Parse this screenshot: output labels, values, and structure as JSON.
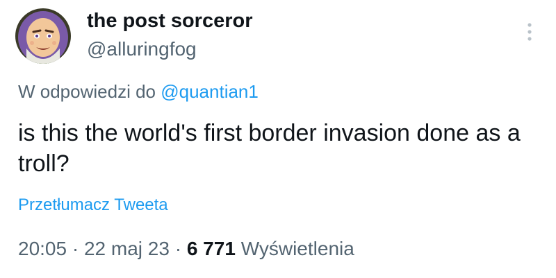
{
  "author": {
    "display_name": "the post sorceror",
    "handle": "@alluringfog",
    "avatar_icon": "buzz-lightyear-avatar-icon"
  },
  "menu": {
    "icon": "more-vertical-icon"
  },
  "reply": {
    "prefix": "W odpowiedzi do",
    "mention": "@quantian1"
  },
  "tweet": {
    "text": "is this the world's first border invasion done as a troll?"
  },
  "translate": {
    "label": "Przetłumacz Tweeta"
  },
  "meta": {
    "time": "20:05",
    "separator": "·",
    "date": "22 maj 23",
    "views_count": "6 771",
    "views_label": "Wyświetlenia"
  },
  "colors": {
    "text_primary": "#0f1419",
    "text_secondary": "#536471",
    "link": "#1d9bf0"
  }
}
